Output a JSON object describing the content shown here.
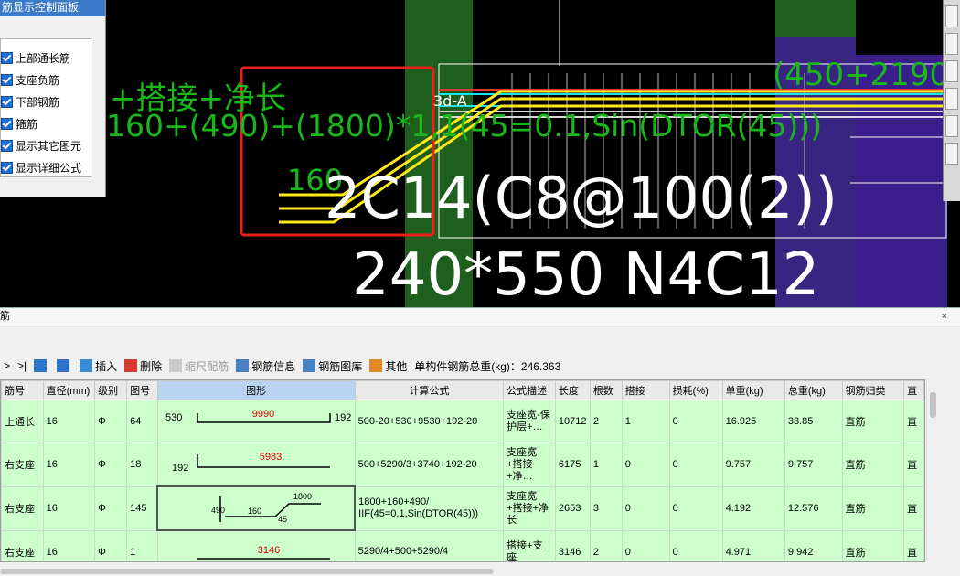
{
  "control_panel": {
    "title": "筋显示控制面板",
    "options": [
      "上部通长筋",
      "支座负筋",
      "下部钢筋",
      "箍筋",
      "显示其它图元",
      "显示详细公式"
    ]
  },
  "cad": {
    "formula_line1": "+搭接+净长",
    "formula_line2": "160+(490)+(1800)*1,1(45=0.1,Sin(DTOR(45)))",
    "label_160": "160",
    "label_3d": "3d-A",
    "rebar_spec": "2C14(C8@100(2))",
    "section": "240*550 N4C12",
    "top_right": "(450+2190/",
    "colors": {
      "green_band": "#1e5f1e",
      "purple_band": "#3a1f8c",
      "highlight": "#e8201a",
      "rebar_yellow": "#ffe81a",
      "cyan": "#18e5f2"
    }
  },
  "bottom_panel": {
    "title": "筋",
    "close": "×",
    "toolbar": {
      "nav": ">",
      "nav_end": ">|",
      "insert": "插入",
      "delete": "删除",
      "scale": "缩尺配筋",
      "info": "钢筋信息",
      "library": "钢筋图库",
      "other": "其他",
      "total_label": "单构件钢筋总重(kg)：246.363"
    },
    "columns": [
      "筋号",
      "直径(mm)",
      "级别",
      "图号",
      "图形",
      "计算公式",
      "公式描述",
      "长度",
      "根数",
      "搭接",
      "损耗(%)",
      "单重(kg)",
      "总重(kg)",
      "钢筋归类",
      "直"
    ],
    "rows": [
      {
        "name": "上通长",
        "dia": "16",
        "grade": "Φ",
        "fig": "64",
        "shape": {
          "left": "530",
          "mid": "9990",
          "right": "192"
        },
        "formula": "500-20+530+9530+192-20",
        "desc": "支座宽-保护层+…",
        "len": "10712",
        "count": "2",
        "lap": "1",
        "loss": "0",
        "unit": "16.925",
        "total": "33.85",
        "cat": "直筋",
        "extra": "直"
      },
      {
        "name": "右支座",
        "dia": "16",
        "grade": "Φ",
        "fig": "18",
        "shape": {
          "left": "192",
          "mid": "5983",
          "right": ""
        },
        "formula": "500+5290/3+3740+192-20",
        "desc": "支座宽+搭接+净…",
        "len": "6175",
        "count": "1",
        "lap": "0",
        "loss": "0",
        "unit": "9.757",
        "total": "9.757",
        "cat": "直筋",
        "extra": "直"
      },
      {
        "name": "右支座",
        "dia": "16",
        "grade": "Φ",
        "fig": "145",
        "shape": {
          "a": "490",
          "b": "160",
          "c": "1800",
          "d": "45"
        },
        "formula": "1800+160+490/\nIIF(45=0,1,Sin(DTOR(45)))",
        "desc": "支座宽+搭接+净长",
        "len": "2653",
        "count": "3",
        "lap": "0",
        "loss": "0",
        "unit": "4.192",
        "total": "12.576",
        "cat": "直筋",
        "extra": "直"
      },
      {
        "name": "右支座",
        "dia": "16",
        "grade": "Φ",
        "fig": "1",
        "shape": {
          "mid": "3146"
        },
        "formula": "5290/4+500+5290/4",
        "desc": "搭接+支座",
        "len": "3146",
        "count": "2",
        "lap": "0",
        "loss": "0",
        "unit": "4.971",
        "total": "9.942",
        "cat": "直筋",
        "extra": "直"
      }
    ]
  }
}
